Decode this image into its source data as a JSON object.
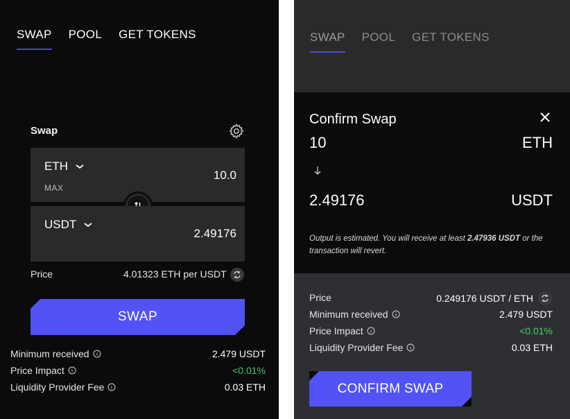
{
  "left": {
    "nav": [
      "SWAP",
      "POOL",
      "GET TOKENS"
    ],
    "card_title": "Swap",
    "from": {
      "symbol": "ETH",
      "amount": "10.0",
      "max_label": "MAX"
    },
    "to": {
      "symbol": "USDT",
      "amount": "2.49176"
    },
    "price_label": "Price",
    "price_value": "4.01323 ETH per USDT",
    "swap_button": "SWAP",
    "details": [
      {
        "label": "Minimum received",
        "value": "2.479 USDT"
      },
      {
        "label": "Price Impact",
        "value": "<0.01%"
      },
      {
        "label": "Liquidity Provider Fee",
        "value": "0.03 ETH"
      }
    ]
  },
  "right": {
    "nav": [
      "SWAP",
      "POOL",
      "GET TOKENS"
    ],
    "modal_title": "Confirm Swap",
    "from": {
      "amount": "10",
      "symbol": "ETH"
    },
    "to": {
      "amount": "2.49176",
      "symbol": "USDT"
    },
    "note_before": "Output is estimated. You will receive at least ",
    "note_bold": "2.47936 USDT",
    "note_after": " or the transaction will revert.",
    "details": [
      {
        "label": "Price",
        "value": "0.249176 USDT / ETH"
      },
      {
        "label": "Minimum received",
        "value": "2.479 USDT"
      },
      {
        "label": "Price Impact",
        "value": "<0.01%"
      },
      {
        "label": "Liquidity Provider Fee",
        "value": "0.03 ETH"
      }
    ],
    "confirm_button": "CONFIRM SWAP"
  },
  "colors": {
    "accent": "#5252f5",
    "positive": "#4cc96a",
    "panel_dark": "#0b0b0c"
  },
  "icons": [
    "gear-icon",
    "chevron-down-icon",
    "swap-direction-icon",
    "refresh-icon",
    "info-icon",
    "close-icon",
    "arrow-down-icon"
  ]
}
